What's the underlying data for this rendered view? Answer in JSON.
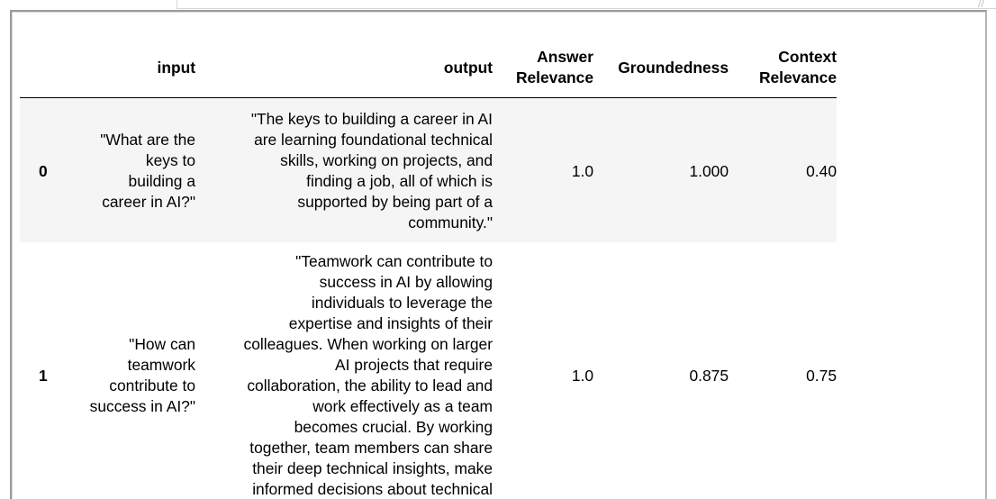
{
  "table": {
    "columns": [
      "input",
      "output",
      "Answer Relevance",
      "Groundedness",
      "Context Relevance"
    ],
    "column_lines": {
      "answer_relevance": [
        "Answer",
        "Relevance"
      ],
      "context_relevance": [
        "Context",
        "Relevance"
      ]
    },
    "rows": [
      {
        "index": "0",
        "input_lines": [
          "\"What are the",
          "keys to",
          "building a",
          "career in AI?\""
        ],
        "output_lines": [
          "\"The keys to building a career in AI",
          "are learning foundational technical",
          "skills, working on projects, and",
          "finding a job, all of which is",
          "supported by being part of a",
          "community.\""
        ],
        "answer_relevance": "1.0",
        "groundedness": "1.000",
        "context_relevance": "0.40"
      },
      {
        "index": "1",
        "input_lines": [
          "\"How can",
          "teamwork",
          "contribute to",
          "success in AI?\""
        ],
        "output_lines": [
          "\"Teamwork can contribute to",
          "success in AI by allowing",
          "individuals to leverage the",
          "expertise and insights of their",
          "colleagues. When working on larger",
          "AI projects that require",
          "collaboration, the ability to lead and",
          "work effectively as a team",
          "becomes crucial. By working",
          "together, team members can share",
          "their deep technical insights, make",
          "informed decisions about technical"
        ],
        "answer_relevance": "1.0",
        "groundedness": "0.875",
        "context_relevance": "0.75"
      }
    ]
  },
  "icons": {
    "resize_grip": "resize-grip-icon"
  }
}
